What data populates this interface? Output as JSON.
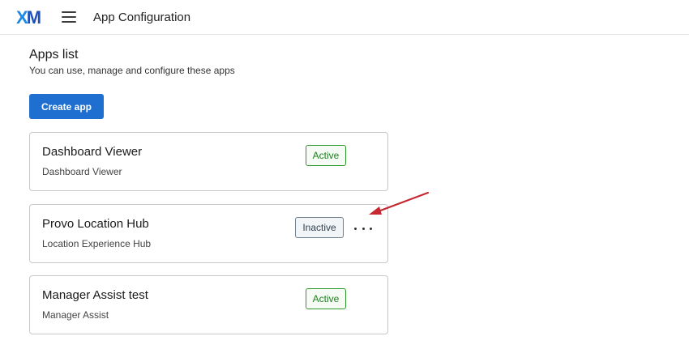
{
  "header": {
    "logo": {
      "x": "X",
      "m": "M"
    },
    "menu_icon": "hamburger-menu-icon",
    "title": "App Configuration"
  },
  "page": {
    "heading": "Apps list",
    "subheading": "You can use, manage and configure these apps",
    "create_button": "Create app"
  },
  "apps": [
    {
      "name": "Dashboard Viewer",
      "description": "Dashboard Viewer",
      "status": "Active"
    },
    {
      "name": "Provo Location Hub",
      "description": "Location Experience Hub",
      "status": "Inactive",
      "menu_icon": "more-options-icon"
    },
    {
      "name": "Manager Assist test",
      "description": "Manager Assist",
      "status": "Active"
    }
  ],
  "colors": {
    "primary": "#1f6fd1",
    "active": "#2e9a2e",
    "inactive": "#6f7d89",
    "annotation_arrow": "#c62832"
  }
}
